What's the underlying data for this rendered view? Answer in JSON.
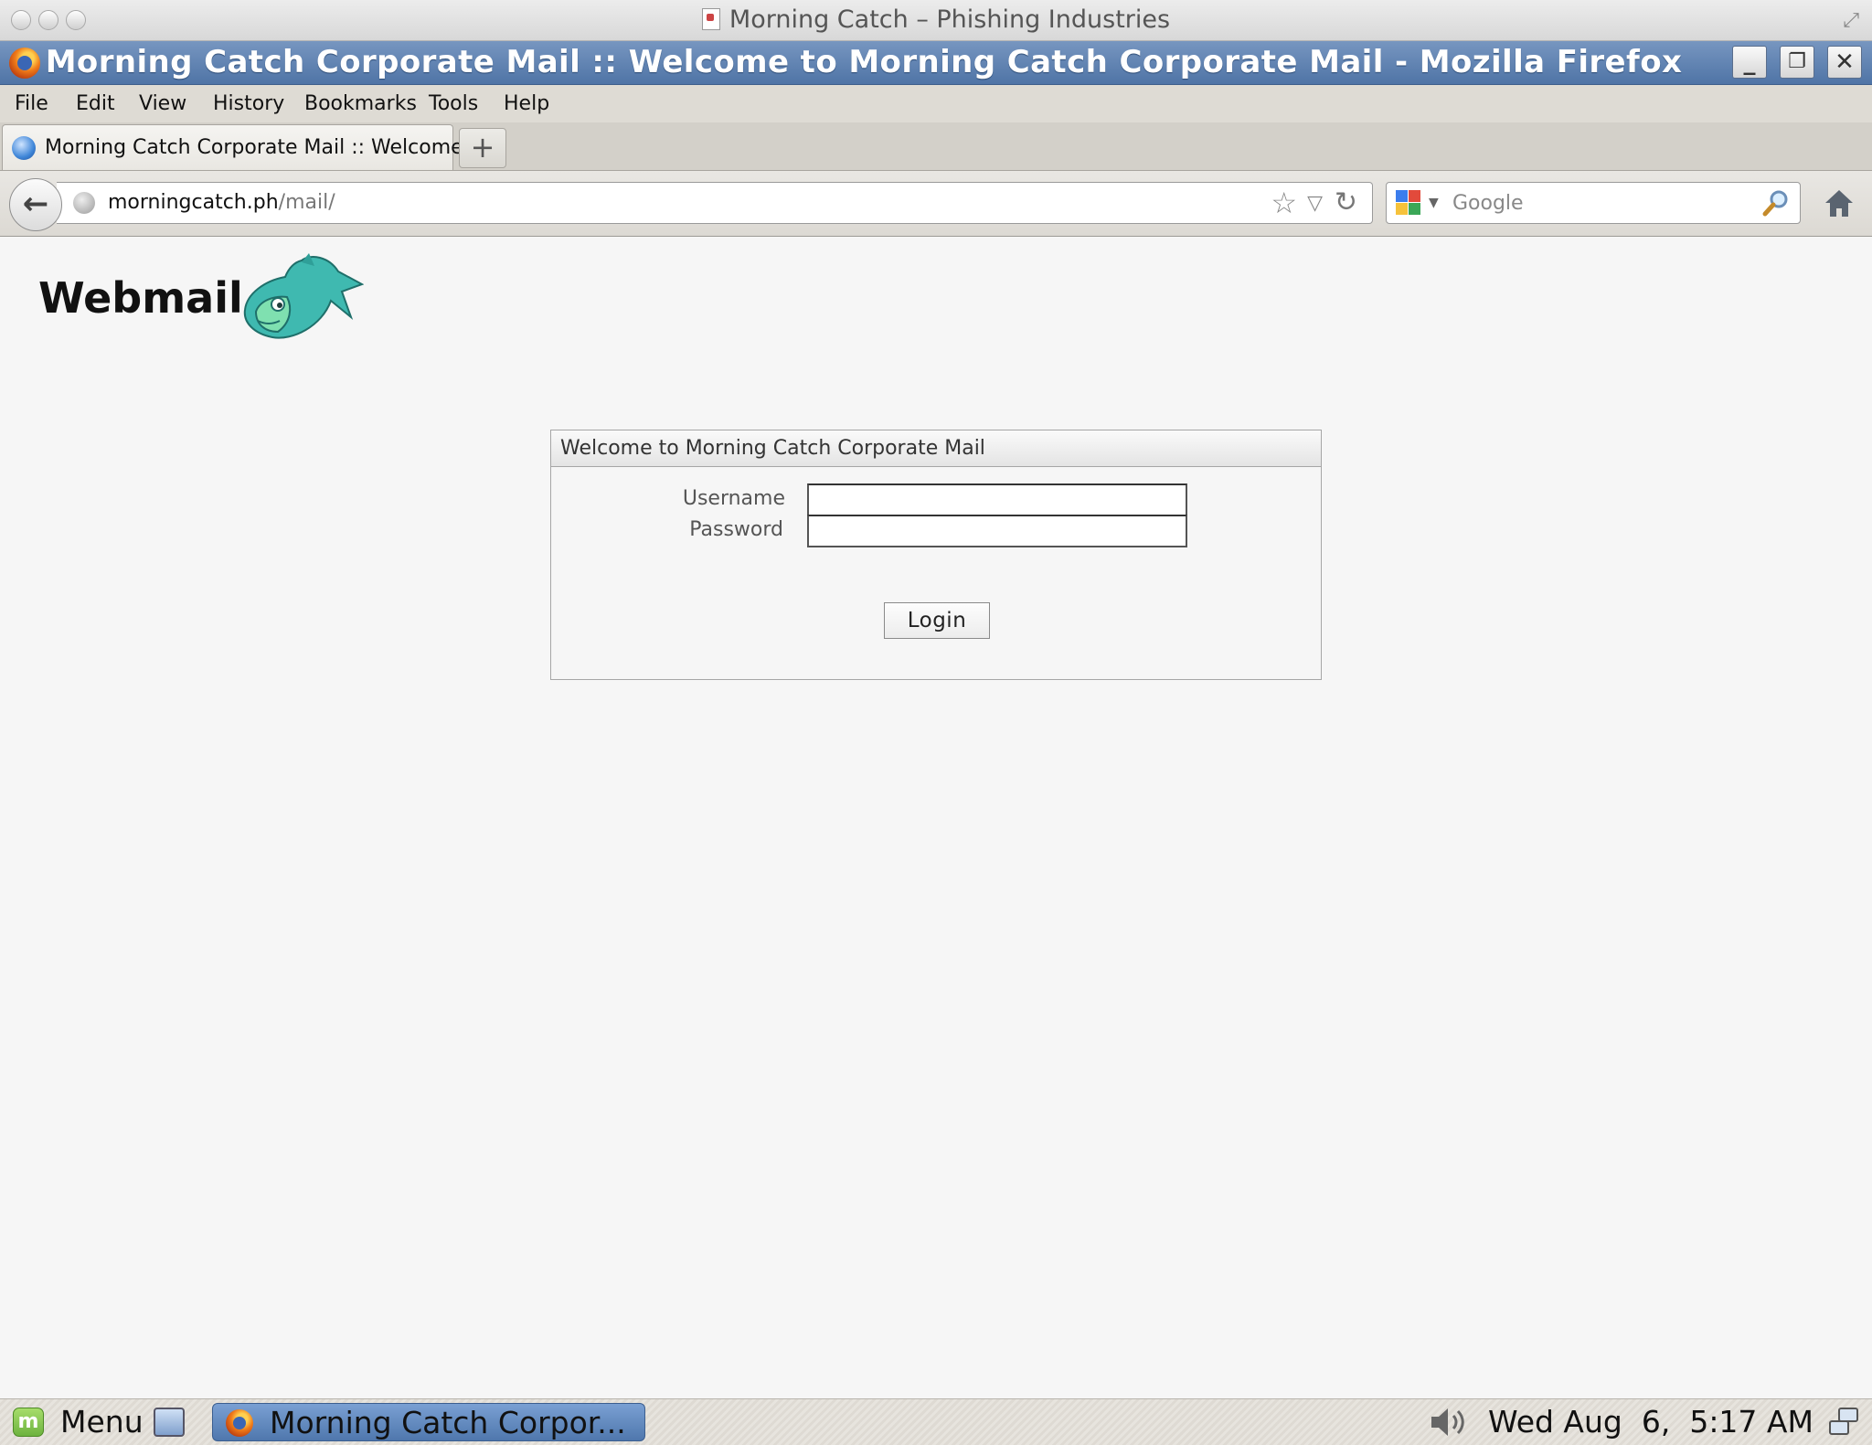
{
  "mac_window": {
    "title": "Morning Catch – Phishing Industries"
  },
  "firefox_window": {
    "title": "Morning Catch Corporate Mail :: Welcome to Morning Catch Corporate Mail - Mozilla Firefox"
  },
  "menubar": {
    "items": [
      {
        "label": "File"
      },
      {
        "label": "Edit"
      },
      {
        "label": "View"
      },
      {
        "label": "History"
      },
      {
        "label": "Bookmarks"
      },
      {
        "label": "Tools"
      },
      {
        "label": "Help"
      }
    ]
  },
  "tabs": [
    {
      "label": "Morning Catch Corporate Mail :: Welcome t...",
      "icon": "webmail-globe-icon"
    }
  ],
  "new_tab_label": "+",
  "navbar": {
    "url_host": "morningcatch.ph",
    "url_path": "/mail/",
    "search_placeholder": "Google"
  },
  "page": {
    "brand": "Webmail",
    "login": {
      "header": "Welcome to Morning Catch Corporate Mail",
      "username_label": "Username",
      "password_label": "Password",
      "username_value": "",
      "password_value": "",
      "button_label": "Login"
    }
  },
  "taskbar": {
    "menu_label": "Menu",
    "task_label": "Morning Catch Corpor...",
    "clock": "Wed Aug  6,  5:17 AM"
  },
  "colors": {
    "firefox_titlebar": "#5f80b0",
    "page_background": "#f6f6f6",
    "task_button": "#6a8fc4"
  }
}
